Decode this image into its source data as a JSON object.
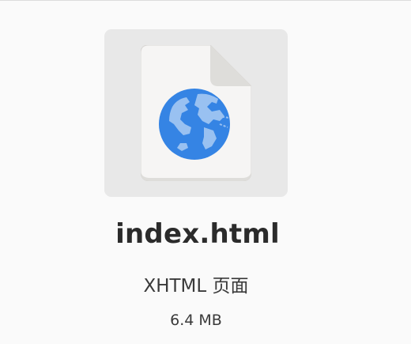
{
  "file": {
    "name": "index.html",
    "type": "XHTML 页面",
    "size": "6.4 MB",
    "icon": "html-document-globe-icon"
  },
  "colors": {
    "background": "#fafafa",
    "tile": "#e8e8e8",
    "paper": "#f6f5f4",
    "globe_ocean": "#3584e4",
    "globe_land": "#99c1f1"
  }
}
